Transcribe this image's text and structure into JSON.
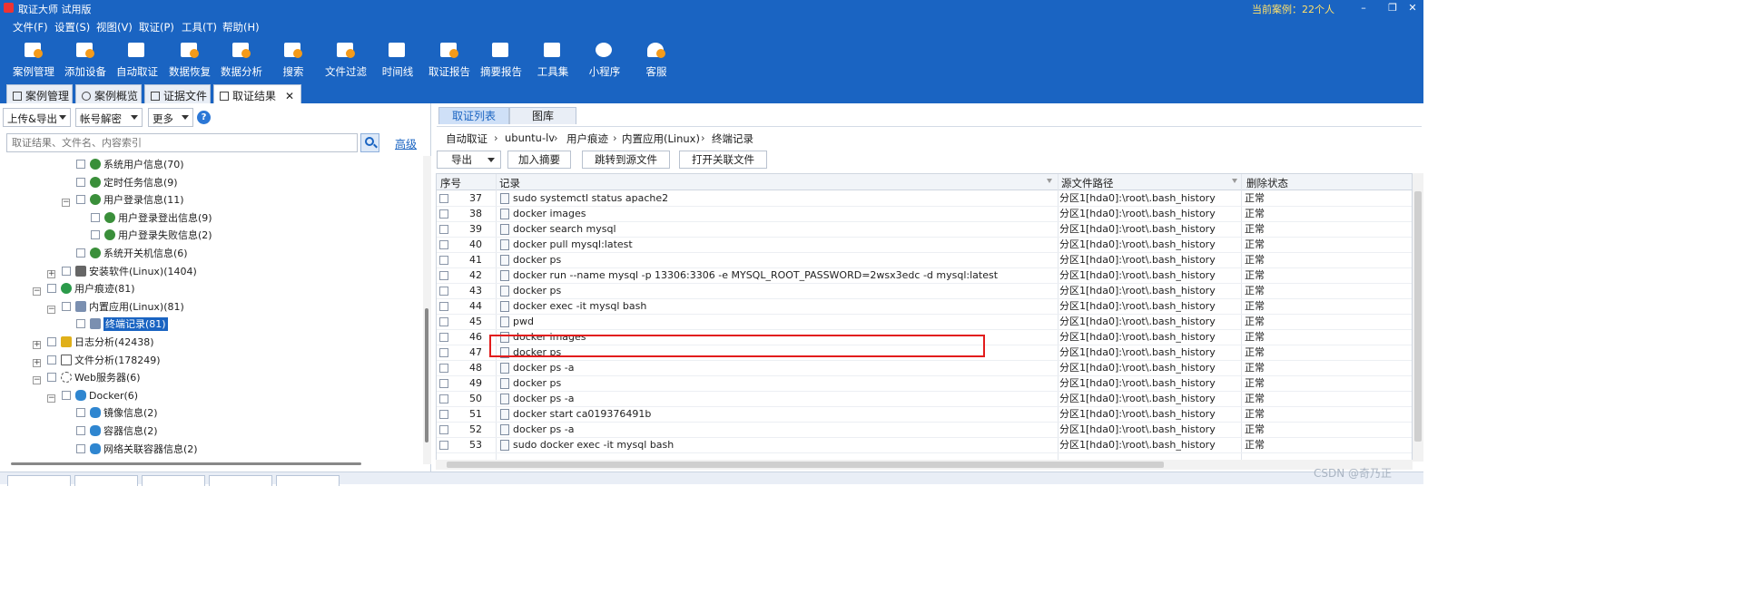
{
  "app": {
    "title": "取证大师 试用版",
    "current_case": "当前案例：22个人"
  },
  "menu": [
    "文件(F)",
    "设置(S)",
    "视图(V)",
    "取证(P)",
    "工具(T)",
    "帮助(H)"
  ],
  "toolbar": [
    {
      "label": "案例管理",
      "icon": "case-manage-icon"
    },
    {
      "label": "添加设备",
      "icon": "add-device-icon"
    },
    {
      "label": "自动取证",
      "icon": "auto-forensics-icon"
    },
    {
      "label": "数据恢复",
      "icon": "data-recovery-icon"
    },
    {
      "label": "数据分析",
      "icon": "data-analysis-icon"
    },
    {
      "label": "搜索",
      "icon": "search-doc-icon"
    },
    {
      "label": "文件过滤",
      "icon": "file-filter-icon"
    },
    {
      "label": "时间线",
      "icon": "timeline-icon"
    },
    {
      "label": "取证报告",
      "icon": "report-icon"
    },
    {
      "label": "摘要报告",
      "icon": "summary-report-icon"
    },
    {
      "label": "工具集",
      "icon": "toolset-icon"
    },
    {
      "label": "小程序",
      "icon": "miniprogram-icon"
    },
    {
      "label": "客服",
      "icon": "customer-service-icon"
    }
  ],
  "tabs": [
    {
      "label": "案例管理"
    },
    {
      "label": "案例概览"
    },
    {
      "label": "证据文件"
    },
    {
      "label": "取证结果",
      "active": true
    }
  ],
  "left_panel": {
    "dropdowns": [
      "上传&导出",
      "帐号解密",
      "更多"
    ],
    "help": "?",
    "search_placeholder": "取证结果、文件名、内容索引",
    "advanced": "高级",
    "tree": [
      {
        "label": "系统用户信息(70)",
        "level": 3,
        "icon": "globe"
      },
      {
        "label": "定时任务信息(9)",
        "level": 3,
        "icon": "globe"
      },
      {
        "label": "用户登录信息(11)",
        "level": 3,
        "icon": "globe",
        "expander": "−"
      },
      {
        "label": "用户登录登出信息(9)",
        "level": 4,
        "icon": "globe"
      },
      {
        "label": "用户登录失败信息(2)",
        "level": 4,
        "icon": "globe"
      },
      {
        "label": "系统开关机信息(6)",
        "level": 3,
        "icon": "globe"
      },
      {
        "label": "安装软件(Linux)(1404)",
        "level": 2,
        "icon": "package",
        "expander": "+"
      },
      {
        "label": "用户痕迹(81)",
        "level": 1,
        "icon": "user",
        "expander": "−"
      },
      {
        "label": "内置应用(Linux)(81)",
        "level": 2,
        "icon": "app",
        "expander": "−"
      },
      {
        "label": "终端记录(81)",
        "level": 3,
        "icon": "app",
        "selected": true
      },
      {
        "label": "日志分析(42438)",
        "level": 1,
        "icon": "log",
        "expander": "+"
      },
      {
        "label": "文件分析(178249)",
        "level": 1,
        "icon": "file",
        "expander": "+"
      },
      {
        "label": "Web服务器(6)",
        "level": 1,
        "icon": "web",
        "expander": "−"
      },
      {
        "label": "Docker(6)",
        "level": 2,
        "icon": "docker",
        "expander": "−"
      },
      {
        "label": "镜像信息(2)",
        "level": 3,
        "icon": "docker"
      },
      {
        "label": "容器信息(2)",
        "level": 3,
        "icon": "docker"
      },
      {
        "label": "网络关联容器信息(2)",
        "level": 3,
        "icon": "docker"
      }
    ]
  },
  "right_panel": {
    "tabs": [
      {
        "label": "取证列表",
        "active": true
      },
      {
        "label": "图库"
      }
    ],
    "breadcrumb": [
      "自动取证",
      "ubuntu-lv",
      "用户痕迹",
      "内置应用(Linux)",
      "终端记录"
    ],
    "actions": [
      "导出",
      "加入摘要",
      "跳转到源文件",
      "打开关联文件"
    ],
    "columns": [
      "序号",
      "记录",
      "源文件路径",
      "删除状态"
    ],
    "rows": [
      {
        "num": "37",
        "record": "sudo systemctl status  apache2",
        "path": "分区1[hda0]:\\root\\.bash_history",
        "status": "正常"
      },
      {
        "num": "38",
        "record": "docker images",
        "path": "分区1[hda0]:\\root\\.bash_history",
        "status": "正常"
      },
      {
        "num": "39",
        "record": "docker search mysql",
        "path": "分区1[hda0]:\\root\\.bash_history",
        "status": "正常"
      },
      {
        "num": "40",
        "record": "docker pull mysql:latest",
        "path": "分区1[hda0]:\\root\\.bash_history",
        "status": "正常"
      },
      {
        "num": "41",
        "record": "docker ps",
        "path": "分区1[hda0]:\\root\\.bash_history",
        "status": "正常"
      },
      {
        "num": "42",
        "record": "docker run --name mysql -p 13306:3306 -e MYSQL_ROOT_PASSWORD=2wsx3edc -d mysql:latest",
        "path": "分区1[hda0]:\\root\\.bash_history",
        "status": "正常",
        "highlighted": true
      },
      {
        "num": "43",
        "record": "docker ps",
        "path": "分区1[hda0]:\\root\\.bash_history",
        "status": "正常"
      },
      {
        "num": "44",
        "record": "docker exec -it mysql bash",
        "path": "分区1[hda0]:\\root\\.bash_history",
        "status": "正常"
      },
      {
        "num": "45",
        "record": "pwd",
        "path": "分区1[hda0]:\\root\\.bash_history",
        "status": "正常"
      },
      {
        "num": "46",
        "record": "docker images",
        "path": "分区1[hda0]:\\root\\.bash_history",
        "status": "正常"
      },
      {
        "num": "47",
        "record": "docker ps",
        "path": "分区1[hda0]:\\root\\.bash_history",
        "status": "正常"
      },
      {
        "num": "48",
        "record": "docker ps -a",
        "path": "分区1[hda0]:\\root\\.bash_history",
        "status": "正常"
      },
      {
        "num": "49",
        "record": "docker ps",
        "path": "分区1[hda0]:\\root\\.bash_history",
        "status": "正常"
      },
      {
        "num": "50",
        "record": "docker ps -a",
        "path": "分区1[hda0]:\\root\\.bash_history",
        "status": "正常"
      },
      {
        "num": "51",
        "record": "docker start ca019376491b",
        "path": "分区1[hda0]:\\root\\.bash_history",
        "status": "正常"
      },
      {
        "num": "52",
        "record": "docker ps -a",
        "path": "分区1[hda0]:\\root\\.bash_history",
        "status": "正常"
      },
      {
        "num": "53",
        "record": "sudo docker exec -it mysql bash",
        "path": "分区1[hda0]:\\root\\.bash_history",
        "status": "正常"
      }
    ]
  },
  "watermark": "CSDN @奇乃正",
  "colors": {
    "titlebar": "#1a64c2",
    "highlight_box": "#e21c1c",
    "selected_node": "#1a64c2",
    "current_case_text": "#ffe06a"
  }
}
